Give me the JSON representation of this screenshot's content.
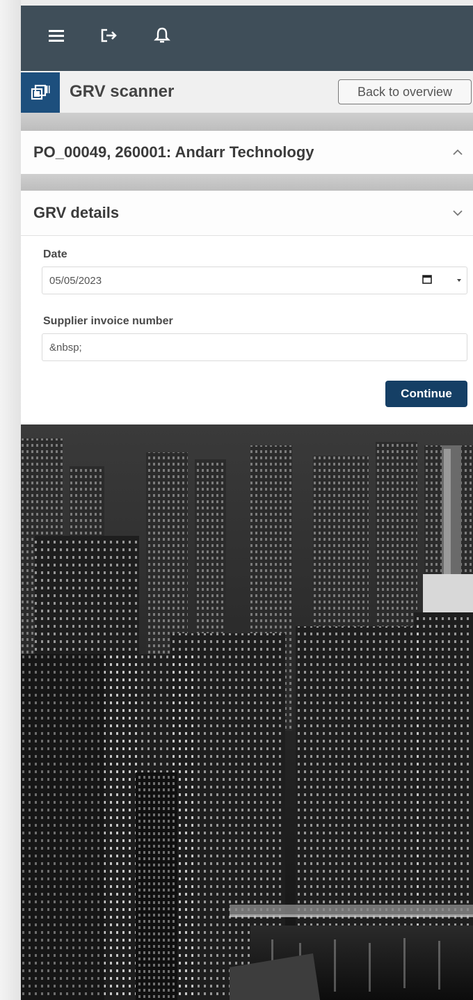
{
  "header": {
    "icons": [
      "menu-icon",
      "logout-icon",
      "bell-icon"
    ]
  },
  "titlebar": {
    "title": "GRV scanner",
    "back_label": "Back to overview"
  },
  "panels": [
    {
      "title": "PO_00049, 260001: Andarr Technology",
      "expanded": true
    },
    {
      "title": "GRV details",
      "expanded": false
    }
  ],
  "form": {
    "date_label": "Date",
    "date_value": "05/05/2023",
    "invoice_label": "Supplier invoice number",
    "invoice_value": "&nbsp;",
    "continue_label": "Continue"
  },
  "colors": {
    "topbar": "#3f4e59",
    "brand": "#1d4f7d",
    "primary_button": "#153f65"
  }
}
